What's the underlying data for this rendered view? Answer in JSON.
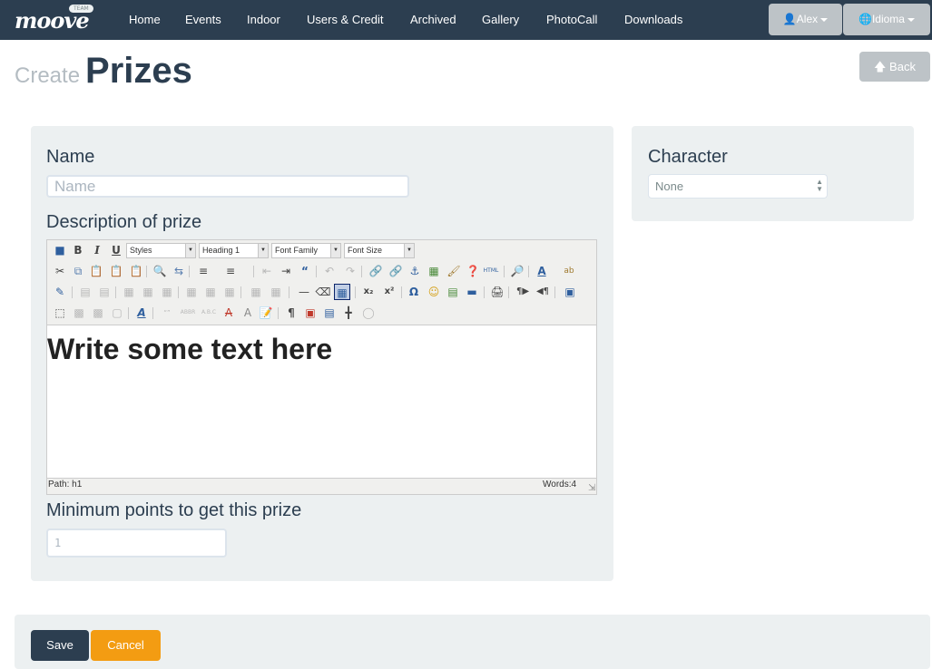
{
  "brand": {
    "logo": "moove",
    "badge": "TEAM"
  },
  "nav": {
    "links": [
      "Home",
      "Events",
      "Indoor",
      "Users & Credit",
      "Archived",
      "Gallery",
      "PhotoCall",
      "Downloads"
    ],
    "user_label": "Alex",
    "language_label": "Idioma"
  },
  "header": {
    "small": "Create",
    "title": "Prizes",
    "back_label": "Back"
  },
  "form": {
    "name_label": "Name",
    "name_placeholder": "Name",
    "description_label": "Description of prize",
    "min_points_label": "Minimum points to get this prize",
    "min_points_placeholder": "1"
  },
  "editor": {
    "styles_select": "Styles",
    "format_select": "Heading 1",
    "font_family_select": "Font Family",
    "font_size_select": "Font Size",
    "content": "Write some text here",
    "path": "Path: h1",
    "words": "Words:4"
  },
  "sidebar": {
    "character_label": "Character",
    "character_value": "None"
  },
  "actions": {
    "save_label": "Save",
    "cancel_label": "Cancel"
  },
  "colors": {
    "navbar": "#2c3e50",
    "panel": "#ecf0f1",
    "save": "#2c3e50",
    "cancel": "#f39c12",
    "muted_button": "#bdc3c7"
  }
}
